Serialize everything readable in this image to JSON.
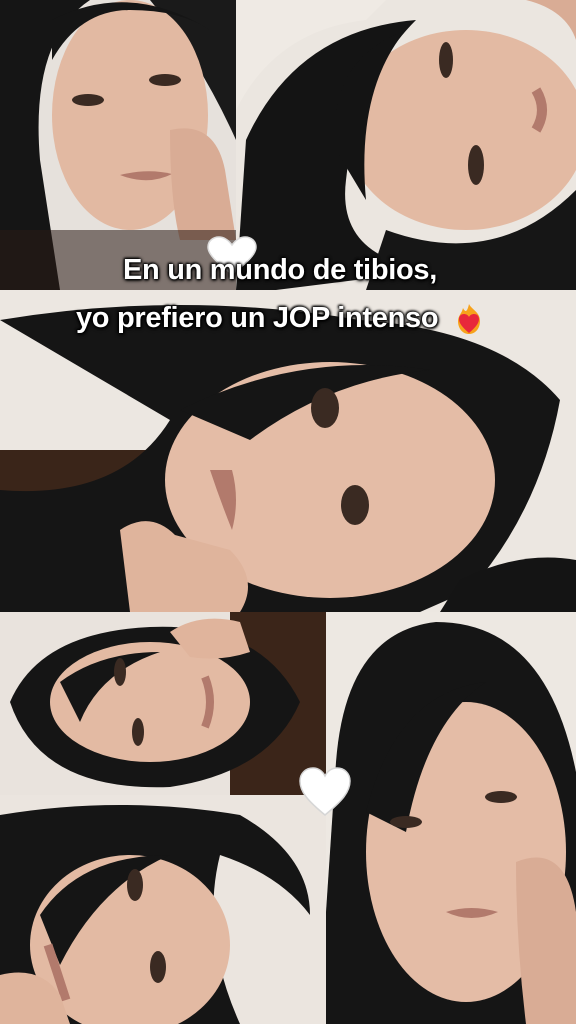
{
  "caption": {
    "line1": "En un mundo de tibios,",
    "line2": "yo prefiero un JOP intenso"
  },
  "decorations": {
    "caption_emoji": "heart-on-fire-icon",
    "heart_icon_top": "white-heart-icon",
    "heart_icon_mid": "white-heart-icon"
  },
  "colors": {
    "hair": "#141414",
    "skin": "#e4bca6",
    "wall": "#ece7e2",
    "caption_text": "#ffffff"
  }
}
